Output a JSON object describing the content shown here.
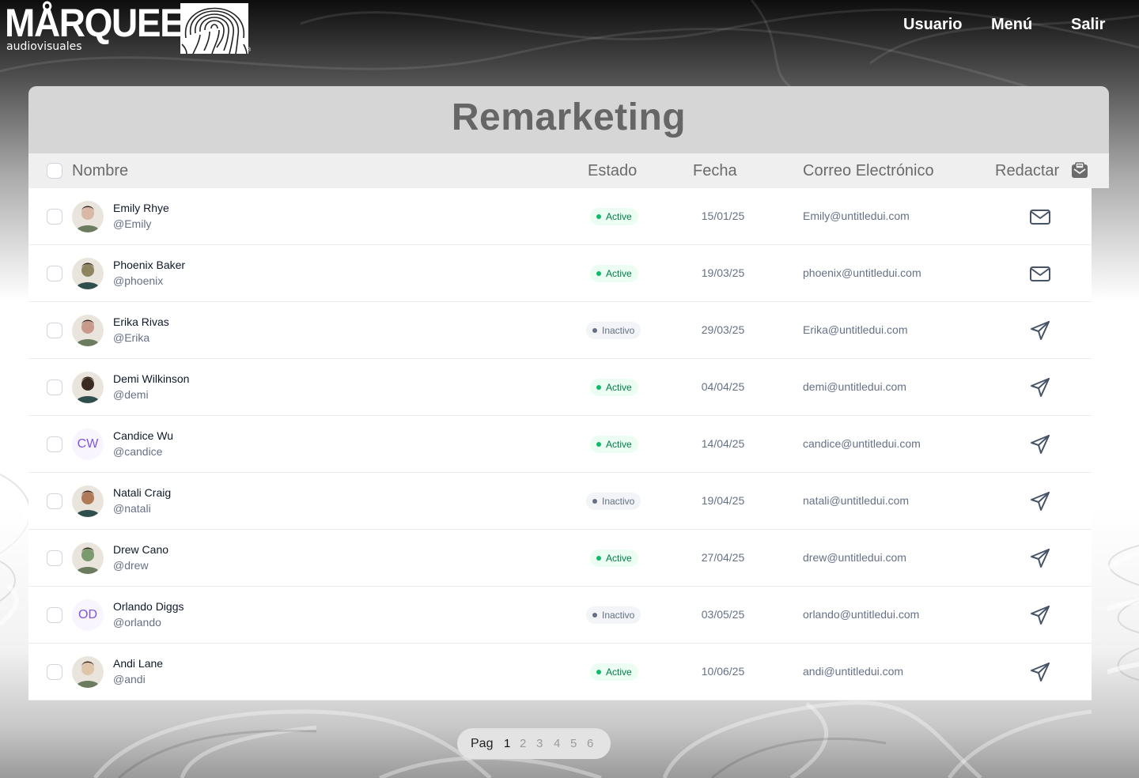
{
  "brand": {
    "name": "MÅRQUEE.",
    "sub": "audiovisuales",
    "reg": "®"
  },
  "nav": {
    "usuario": "Usuario",
    "menu": "Menú",
    "salir": "Salir"
  },
  "page": {
    "title": "Remarketing"
  },
  "table": {
    "headers": {
      "nombre": "Nombre",
      "estado": "Estado",
      "fecha": "Fecha",
      "correo": "Correo Electrónico",
      "redactar": "Redactar"
    },
    "rows": [
      {
        "name": "Emily Rhye",
        "handle": "@Emily",
        "status": "Active",
        "status_kind": "active",
        "date": "15/01/25",
        "email": "Emily@untitledui.com",
        "action_icon": "mail-icon",
        "avatar": "photo",
        "avatar_color": "#d9b8a6"
      },
      {
        "name": "Phoenix Baker",
        "handle": "@phoenix",
        "status": "Active",
        "status_kind": "active",
        "date": "19/03/25",
        "email": "phoenix@untitledui.com",
        "action_icon": "mail-icon",
        "avatar": "photo",
        "avatar_color": "#8c8560"
      },
      {
        "name": "Erika Rivas",
        "handle": "@Erika",
        "status": "Inactivo",
        "status_kind": "inactive",
        "date": "29/03/25",
        "email": "Erika@untitledui.com",
        "action_icon": "send-icon",
        "avatar": "photo",
        "avatar_color": "#c79a8a"
      },
      {
        "name": "Demi Wilkinson",
        "handle": "@demi",
        "status": "Active",
        "status_kind": "active",
        "date": "04/04/25",
        "email": "demi@untitledui.com",
        "action_icon": "send-icon",
        "avatar": "photo",
        "avatar_color": "#3a2a22"
      },
      {
        "name": "Candice Wu",
        "handle": "@candice",
        "status": "Active",
        "status_kind": "active",
        "date": "14/04/25",
        "email": "candice@untitledui.com",
        "action_icon": "send-icon",
        "avatar": "initials",
        "initials": "CW"
      },
      {
        "name": "Natali Craig",
        "handle": "@natali",
        "status": "Inactivo",
        "status_kind": "inactive",
        "date": "19/04/25",
        "email": "natali@untitledui.com",
        "action_icon": "send-icon",
        "avatar": "photo",
        "avatar_color": "#b07a58"
      },
      {
        "name": "Drew Cano",
        "handle": "@drew",
        "status": "Active",
        "status_kind": "active",
        "date": "27/04/25",
        "email": "drew@untitledui.com",
        "action_icon": "send-icon",
        "avatar": "photo",
        "avatar_color": "#7b9a6e"
      },
      {
        "name": "Orlando Diggs",
        "handle": "@orlando",
        "status": "Inactivo",
        "status_kind": "inactive",
        "date": "03/05/25",
        "email": "orlando@untitledui.com",
        "action_icon": "send-icon",
        "avatar": "initials",
        "initials": "OD"
      },
      {
        "name": "Andi Lane",
        "handle": "@andi",
        "status": "Active",
        "status_kind": "active",
        "date": "10/06/25",
        "email": "andi@untitledui.com",
        "action_icon": "send-icon",
        "avatar": "photo",
        "avatar_color": "#e0c6a8"
      }
    ]
  },
  "pagination": {
    "label": "Pag",
    "pages": [
      "1",
      "2",
      "3",
      "4",
      "5",
      "6"
    ],
    "current": "1"
  },
  "colors": {
    "active_text": "#027a48",
    "active_bg": "#ecfdf3",
    "inactive_text": "#667085",
    "inactive_bg": "#f2f4f7",
    "initials_text": "#7f56d9",
    "initials_bg": "#f9f5ff"
  }
}
